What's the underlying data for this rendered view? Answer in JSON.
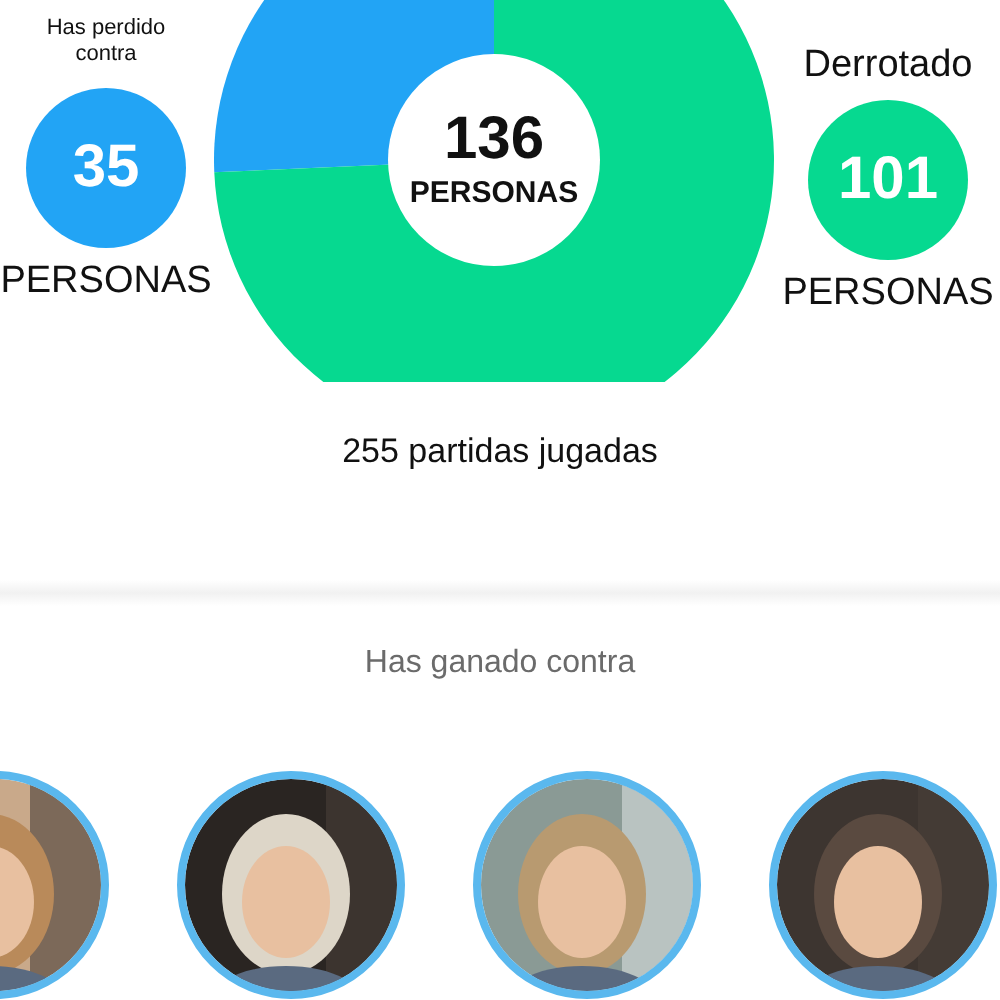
{
  "lost": {
    "caption": "Has perdido contra",
    "count": "35",
    "unit": "PERSONAS",
    "color": "#22a4f5"
  },
  "won": {
    "caption": "Derrotado",
    "count": "101",
    "unit": "PERSONAS",
    "color": "#06d990"
  },
  "total": {
    "count": "136",
    "unit": "PERSONAS"
  },
  "chart_data": {
    "type": "donut",
    "values": [
      25.7,
      74.3
    ]
  },
  "games_played": "255 partidas jugadas",
  "beaten_section": {
    "title": "Has ganado contra"
  }
}
